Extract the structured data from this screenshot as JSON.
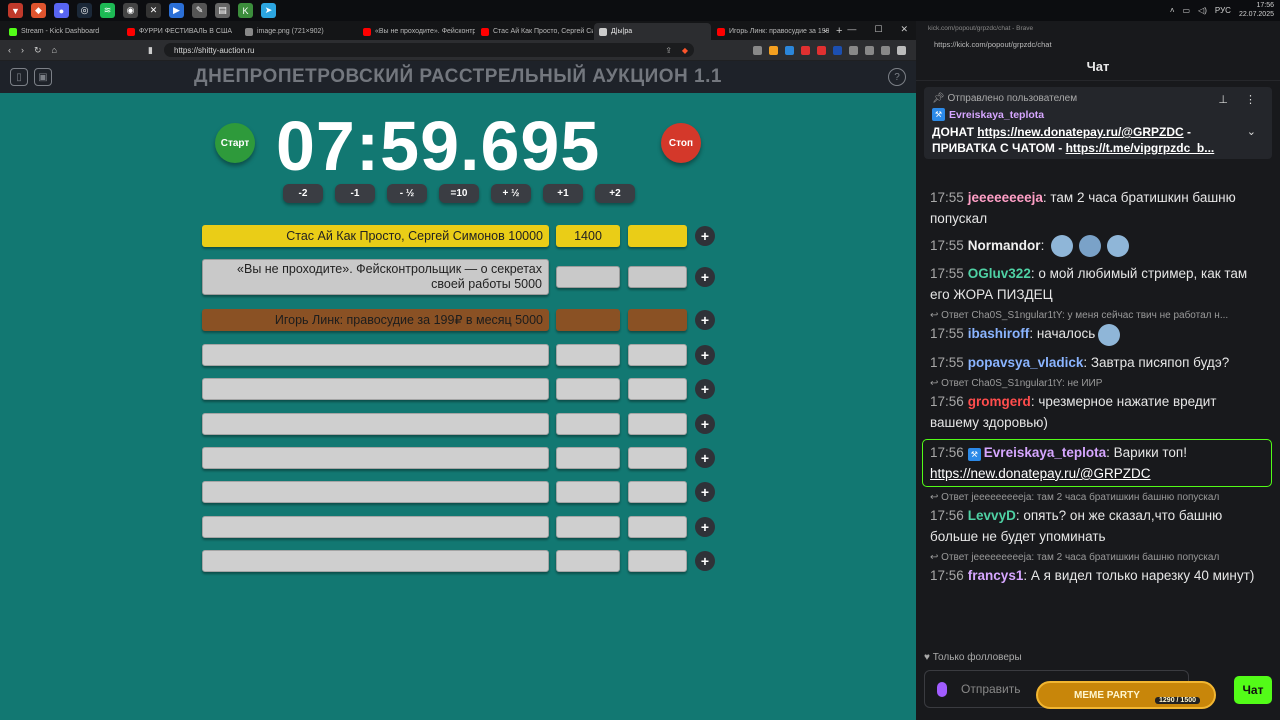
{
  "taskbar": {
    "lang": "РУС",
    "time": "17:56",
    "date": "22.07.2025"
  },
  "browser": {
    "tabs": [
      {
        "label": "Stream - Kick Dashboard",
        "color": "#53fc18"
      },
      {
        "label": "ФУРРИ ФЕСТИВАЛЬ В США",
        "color": "#ff0000"
      },
      {
        "label": "image.png (721×902)",
        "color": "#888888"
      },
      {
        "label": "«Вы не проходите». Фейсконтр",
        "color": "#ff0000"
      },
      {
        "label": "Стас Ай Как Просто, Сергей Сим",
        "color": "#ff0000"
      },
      {
        "label": "Д|ы|ра",
        "color": "#cccccc"
      },
      {
        "label": "Игорь Линк: правосудие за 199Р",
        "color": "#ff0000"
      }
    ],
    "url": "https://shitty-auction.ru"
  },
  "auction": {
    "title": "ДНЕПРОПЕТРОВСКИЙ РАССТРЕЛЬНЫЙ АУКЦИОН 1.1",
    "start_label": "Старт",
    "stop_label": "Стоп",
    "timer": "07:59.695",
    "steps": [
      "-2",
      "-1",
      "- ½",
      "=10",
      "+ ½",
      "+1",
      "+2"
    ],
    "lots": [
      {
        "name": "Стас Ай Как Просто, Сергей Симонов 10000",
        "amount": "1400",
        "style": "yellow"
      },
      {
        "name": "«Вы не проходите». Фейсконтрольщик — о секретах своей работы 5000",
        "amount": "",
        "style": "grey"
      },
      {
        "name": "Игорь Линк: правосудие за 199₽ в месяц 5000",
        "amount": "",
        "style": "brown"
      },
      {
        "name": "",
        "amount": "",
        "style": "empty"
      },
      {
        "name": "",
        "amount": "",
        "style": "empty"
      },
      {
        "name": "",
        "amount": "",
        "style": "empty"
      },
      {
        "name": "",
        "amount": "",
        "style": "empty"
      },
      {
        "name": "",
        "amount": "",
        "style": "empty"
      },
      {
        "name": "",
        "amount": "",
        "style": "empty"
      },
      {
        "name": "",
        "amount": "",
        "style": "empty"
      }
    ]
  },
  "chat": {
    "window_title": "kick.com/popout/grpzdc/chat - Brave",
    "url": "https://kick.com/popout/grpzdc/chat",
    "header": "Чат",
    "pinned": {
      "label": "Отправлено пользователем",
      "user": "Evreiskaya_teplota",
      "line1_prefix": "ДОНАТ ",
      "line1_link": "https://new.donatepay.ru/@GRPZDC",
      "line1_suffix": " -",
      "line2_prefix": "ПРИВАТКА С ЧАТОМ - ",
      "line2_link": "https://t.me/vipgrpzdc_b..."
    },
    "messages": [
      {
        "reply": "",
        "time": "17:55",
        "user": "jeeeeeeeeja",
        "color": "#ff9fc6",
        "text": ": там 2 часа братишкин башню попускал",
        "highlight": false
      },
      {
        "reply": "",
        "time": "17:55",
        "user": "Normandor",
        "color": "#f0f0f0",
        "text": ": ",
        "highlight": false,
        "emotes": 3
      },
      {
        "reply": "",
        "time": "17:55",
        "user": "OGluv322",
        "color": "#4fd1a4",
        "text": ": о мой любимый стример, как там его ЖОРА ПИЗДЕЦ",
        "highlight": false
      },
      {
        "reply": "Ответ Cha0S_S1ngular1tY: у меня сейчас твич не работал н...",
        "time": "17:55",
        "user": "ibashiroff",
        "color": "#8ab4ff",
        "text": ": началось",
        "highlight": false,
        "emotes": 1
      },
      {
        "reply": "",
        "time": "17:55",
        "user": "popavsya_vladick",
        "color": "#8ab4ff",
        "text": ": Завтра писяпоп будэ?",
        "highlight": false
      },
      {
        "reply": "Ответ Cha0S_S1ngular1tY: не ИИР",
        "time": "17:56",
        "user": "gromgerd",
        "color": "#ff4d4d",
        "text": ": чрезмерное нажатие вредит вашему здоровью)",
        "highlight": false
      },
      {
        "reply": "",
        "time": "17:56",
        "user": "Evreiskaya_teplota",
        "color": "#d6a6ff",
        "text": ": Варики топ! ",
        "link": "https://new.donatepay.ru/@GRPZDC",
        "highlight": true
      },
      {
        "reply": "Ответ jeeeeeeeeeja: там 2 часа братишкин башню попускал",
        "time": "17:56",
        "user": "LevvyD",
        "color": "#4fd1a4",
        "text": ": опять? он же сказал,что башню больше не будет упоминать",
        "highlight": false
      },
      {
        "reply": "Ответ jeeeeeeeeeja: там 2 часа братишкин башню попускал",
        "time": "17:56",
        "user": "francys1",
        "color": "#d6a6ff",
        "text": ": А я видел только нарезку 40 минут)",
        "highlight": false
      }
    ],
    "followers_only": "Только фолловеры",
    "input_placeholder": "Отправить",
    "meme_party": "MEME PARTY",
    "meme_count": "1290 / 1500",
    "send_label": "Чат"
  }
}
